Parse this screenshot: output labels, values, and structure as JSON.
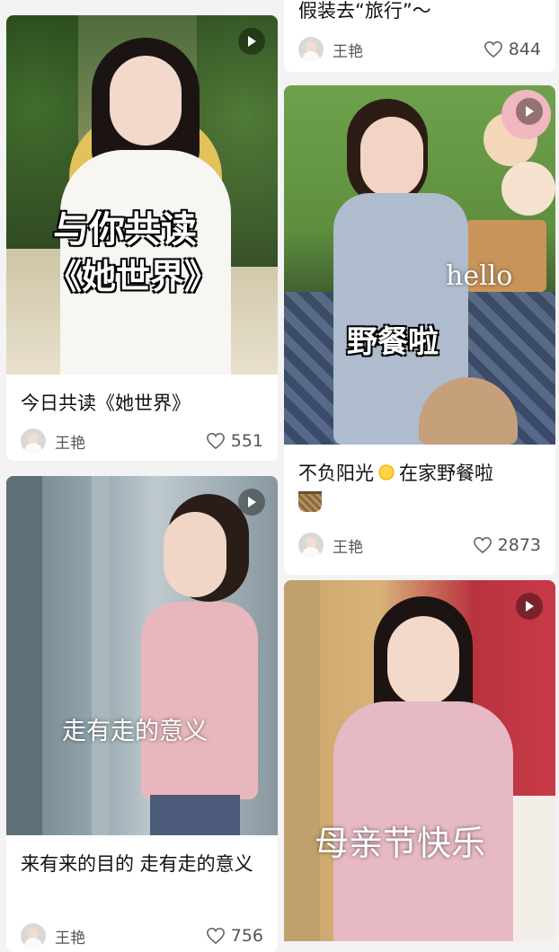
{
  "cards": [
    {
      "title": "今日共读《她世界》",
      "author": "王艳",
      "likes": "551",
      "overlay_line1": "与你共读",
      "overlay_line2": "《她世界》"
    },
    {
      "title": "来有来的目的 走有走的意义",
      "author": "王艳",
      "likes": "756",
      "overlay": "走有走的意义"
    },
    {
      "title_partial": "假装去“旅行”～",
      "author": "王艳",
      "likes": "844"
    },
    {
      "title_part1": "不负阳光",
      "title_part2": "在家野餐啦",
      "author": "王艳",
      "likes": "2873",
      "overlay": "野餐啦",
      "overlay_hello": "hello"
    },
    {
      "overlay": "母亲节快乐"
    }
  ],
  "icons": {
    "play": "play-icon",
    "like": "heart-outline-icon",
    "sun": "sun-emoji",
    "basket": "basket-emoji"
  }
}
